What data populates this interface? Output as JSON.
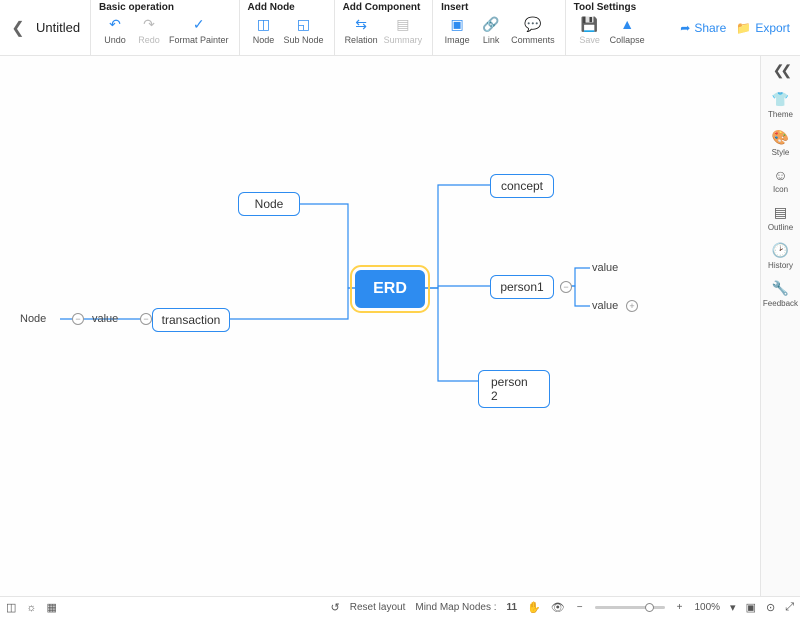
{
  "doc_title": "Untitled",
  "ribbon": {
    "basic": {
      "title": "Basic operation",
      "undo": "Undo",
      "redo": "Redo",
      "format_painter": "Format Painter"
    },
    "add_node": {
      "title": "Add Node",
      "node": "Node",
      "sub_node": "Sub Node"
    },
    "add_component": {
      "title": "Add Component",
      "relation": "Relation",
      "summary": "Summary"
    },
    "insert": {
      "title": "Insert",
      "image": "Image",
      "link": "Link",
      "comments": "Comments"
    },
    "tool": {
      "title": "Tool Settings",
      "save": "Save",
      "collapse": "Collapse"
    }
  },
  "header_actions": {
    "share": "Share",
    "export": "Export"
  },
  "sidebar": {
    "theme": "Theme",
    "style": "Style",
    "icon": "Icon",
    "outline": "Outline",
    "history": "History",
    "feedback": "Feedback"
  },
  "diagram": {
    "root": "ERD",
    "node_top": "Node",
    "transaction": "transaction",
    "left_plain_node": "Node",
    "left_plain_value": "value",
    "concept": "concept",
    "person1": "person1",
    "person2": "person 2",
    "p1_value1": "value",
    "p1_value2": "value"
  },
  "status": {
    "reset_layout": "Reset layout",
    "nodes_label": "Mind Map Nodes :",
    "nodes_count": "11",
    "zoom_pct": "100%"
  }
}
